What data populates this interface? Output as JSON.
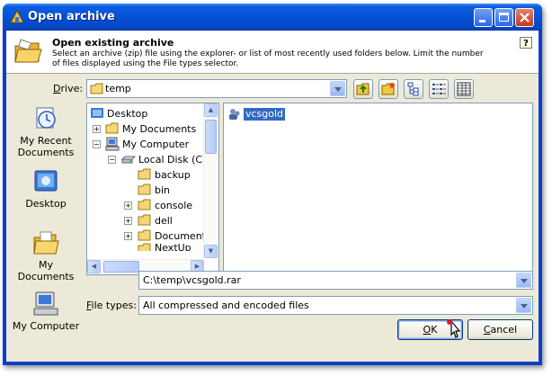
{
  "window": {
    "title": "Open archive",
    "accent": "#0451d6"
  },
  "header": {
    "title": "Open existing archive",
    "description": "Select an archive (zip) file using the explorer- or list of most recently used folders below. Limit the number of files displayed using the File types selector.",
    "help_label": "?"
  },
  "drive": {
    "label_access": "D",
    "label_rest": "rive:",
    "value": "temp"
  },
  "toolbar": {
    "icons": [
      "folder-up-icon",
      "new-folder-icon",
      "tree-view-icon",
      "list-view-icon",
      "details-view-icon"
    ]
  },
  "places": [
    {
      "label": "My Recent Documents",
      "icon": "recent-documents-icon"
    },
    {
      "label": "Desktop",
      "icon": "desktop-icon"
    },
    {
      "label": "My Documents",
      "icon": "my-documents-icon"
    },
    {
      "label": "My Computer",
      "icon": "my-computer-icon"
    }
  ],
  "tree": {
    "desktop": "Desktop",
    "my_documents": "My Documents",
    "my_computer": "My Computer",
    "local_disk": "Local Disk (C:)",
    "backup": "backup",
    "bin": "bin",
    "console": "console",
    "dell": "dell",
    "documents": "Document",
    "next": "NextUp"
  },
  "files": {
    "selected": "vcsgold"
  },
  "path": {
    "value": "C:\\temp\\vcsgold.rar"
  },
  "file_types": {
    "label_access": "F",
    "label_rest": "ile types:",
    "value": "All compressed and encoded files"
  },
  "buttons": {
    "ok_access": "O",
    "ok_rest": "K",
    "cancel_access": "C",
    "cancel_rest": "ancel"
  }
}
